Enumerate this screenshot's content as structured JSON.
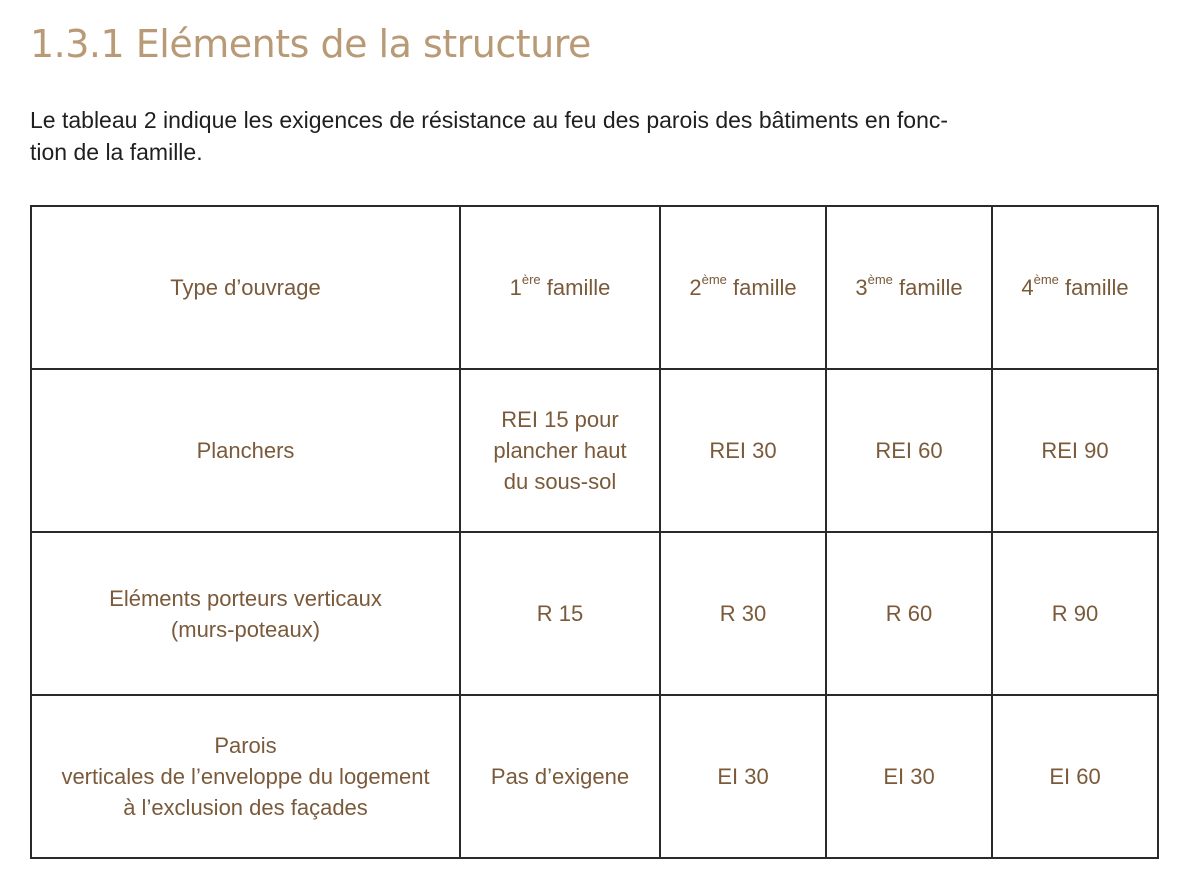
{
  "heading": "1.3.1 Eléments de la structure",
  "intro": "Le tableau 2 indique les exigences de résistance au feu des parois des bâtiments en fonc-\ntion de la famille.",
  "table": {
    "header": {
      "type": "Type d’ouvrage",
      "f1_num": "1",
      "f1_sup": "ère",
      "f2_num": "2",
      "f2_sup": "ème",
      "f3_num": "3",
      "f3_sup": "ème",
      "f4_num": "4",
      "f4_sup": "ème",
      "famille": " famille"
    },
    "rows": [
      {
        "type": "Planchers",
        "f1": "REI 15 pour\nplancher haut\ndu sous-sol",
        "f2": "REI 30",
        "f3": "REI 60",
        "f4": "REI 90"
      },
      {
        "type": "Eléments porteurs verticaux\n(murs-poteaux)",
        "f1": "R 15",
        "f2": "R 30",
        "f3": "R 60",
        "f4": "R 90"
      },
      {
        "type": "Parois\nverticales de l’enveloppe du logement\nà l’exclusion des façades",
        "f1": "Pas d’exigene",
        "f2": "EI 30",
        "f3": "EI 30",
        "f4": "EI 60"
      }
    ]
  }
}
